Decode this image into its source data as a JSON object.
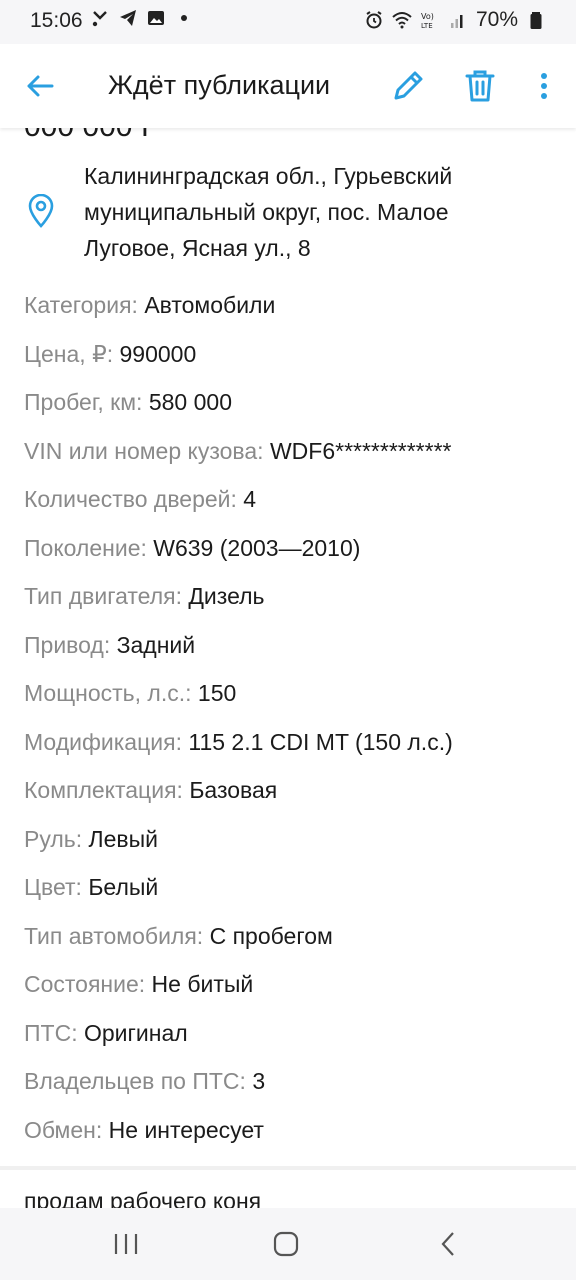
{
  "status_bar": {
    "time": "15:06",
    "battery": "70%",
    "left_icons": [
      "missed-call-icon",
      "telegram-icon",
      "gallery-icon",
      "dot-icon"
    ],
    "right_icons": [
      "alarm-icon",
      "wifi-icon",
      "volte-icon",
      "signal-icon",
      "battery-icon"
    ]
  },
  "header": {
    "title": "Ждёт публикации",
    "accent": "#2a9fe0"
  },
  "listing": {
    "clipped_text": "000 000 I",
    "address": "Калининградская обл., Гурьевский муниципальный округ, пос. Малое Луговое, Ясная ул., 8",
    "properties": [
      {
        "label": "Категория:",
        "value": "Автомобили"
      },
      {
        "label": "Цена, ₽:",
        "value": "990000"
      },
      {
        "label": "Пробег, км:",
        "value": "580 000"
      },
      {
        "label": "VIN или номер кузова:",
        "value": "WDF6*************"
      },
      {
        "label": "Количество дверей:",
        "value": "4"
      },
      {
        "label": "Поколение:",
        "value": "W639 (2003—2010)"
      },
      {
        "label": "Тип двигателя:",
        "value": "Дизель"
      },
      {
        "label": "Привод:",
        "value": "Задний"
      },
      {
        "label": "Мощность, л.с.:",
        "value": "150"
      },
      {
        "label": "Модификация:",
        "value": "115 2.1 CDI MT (150 л.с.)"
      },
      {
        "label": "Комплектация:",
        "value": "Базовая"
      },
      {
        "label": "Руль:",
        "value": "Левый"
      },
      {
        "label": "Цвет:",
        "value": "Белый"
      },
      {
        "label": "Тип автомобиля:",
        "value": "С пробегом"
      },
      {
        "label": "Состояние:",
        "value": "Не битый"
      },
      {
        "label": "ПТС:",
        "value": "Оригинал"
      },
      {
        "label": "Владельцев по ПТС:",
        "value": "3"
      },
      {
        "label": "Обмен:",
        "value": "Не интересует"
      }
    ],
    "description_start": "продам рабочего коня"
  }
}
